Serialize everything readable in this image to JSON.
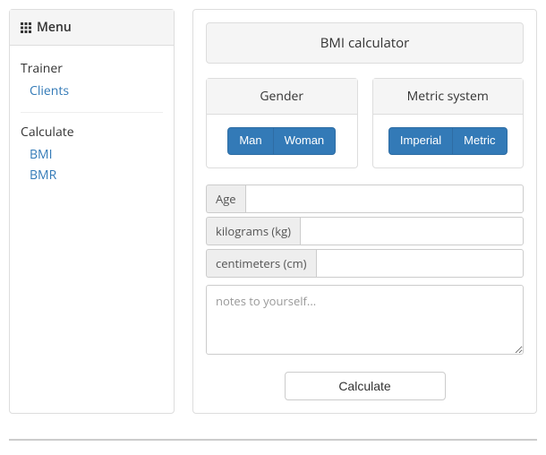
{
  "sidebar": {
    "menu_label": "Menu",
    "sections": [
      {
        "title": "Trainer",
        "links": [
          {
            "label": "Clients"
          }
        ]
      },
      {
        "title": "Calculate",
        "links": [
          {
            "label": "BMI"
          },
          {
            "label": "BMR"
          }
        ]
      }
    ]
  },
  "main": {
    "title": "BMI calculator",
    "gender": {
      "header": "Gender",
      "options": [
        "Man",
        "Woman"
      ]
    },
    "metric_system": {
      "header": "Metric system",
      "options": [
        "Imperial",
        "Metric"
      ]
    },
    "fields": {
      "age_label": "Age",
      "age_value": "",
      "weight_label": "kilograms (kg)",
      "weight_value": "",
      "height_label": "centimeters (cm)",
      "height_value": ""
    },
    "notes": {
      "value": "",
      "placeholder": "notes to yourself..."
    },
    "calculate_label": "Calculate"
  }
}
